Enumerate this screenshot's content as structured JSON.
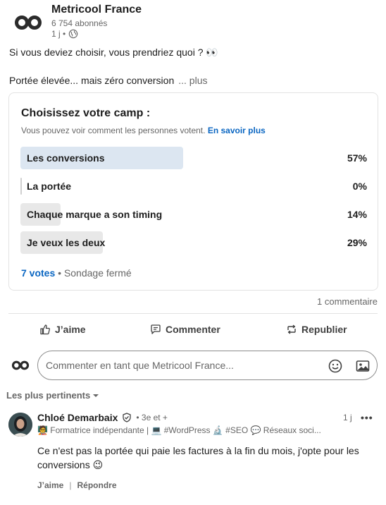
{
  "author": {
    "name": "Metricool France",
    "followers": "6 754 abonnés",
    "time": "1 j •"
  },
  "post": {
    "line1": "Si vous deviez choisir, vous prendriez quoi ? 👀",
    "line2": "Portée élevée... mais zéro conversion",
    "more": "... plus"
  },
  "poll": {
    "title": "Choisissez votre camp :",
    "subtitle": "Vous pouvez voir comment les personnes votent.",
    "learn_more": "En savoir plus",
    "options": [
      {
        "label": "Les conversions",
        "percent": "57%",
        "fraction": 0.57
      },
      {
        "label": "La portée",
        "percent": "0%",
        "fraction": 0
      },
      {
        "label": "Chaque marque a son timing",
        "percent": "14%",
        "fraction": 0.14
      },
      {
        "label": "Je veux les deux",
        "percent": "29%",
        "fraction": 0.29
      }
    ],
    "votes": "7 votes",
    "status": "Sondage fermé"
  },
  "comments_count": "1 commentaire",
  "actions": {
    "like": "J’aime",
    "comment": "Commenter",
    "repost": "Republier"
  },
  "comment_box": {
    "placeholder": "Commenter en tant que Metricool France..."
  },
  "sort_label": "Les plus pertinents",
  "comment": {
    "name": "Chloé Demarbaix",
    "degree": "• 3e et +",
    "time": "1 j",
    "headline": "🧑‍🏫 Formatrice indépendante | 💻 #WordPress 🔬 #SEO 💬 Réseaux soci...",
    "text": "Ce n'est pas la portée qui paie les factures à la fin du mois, j'opte pour les conversions 😉",
    "like": "J’aime",
    "reply": "Répondre",
    "separator": "|"
  },
  "colors": {
    "accent": "#0a66c2",
    "selected_bar": "#dce6f1",
    "bar": "#e8e8e8"
  }
}
